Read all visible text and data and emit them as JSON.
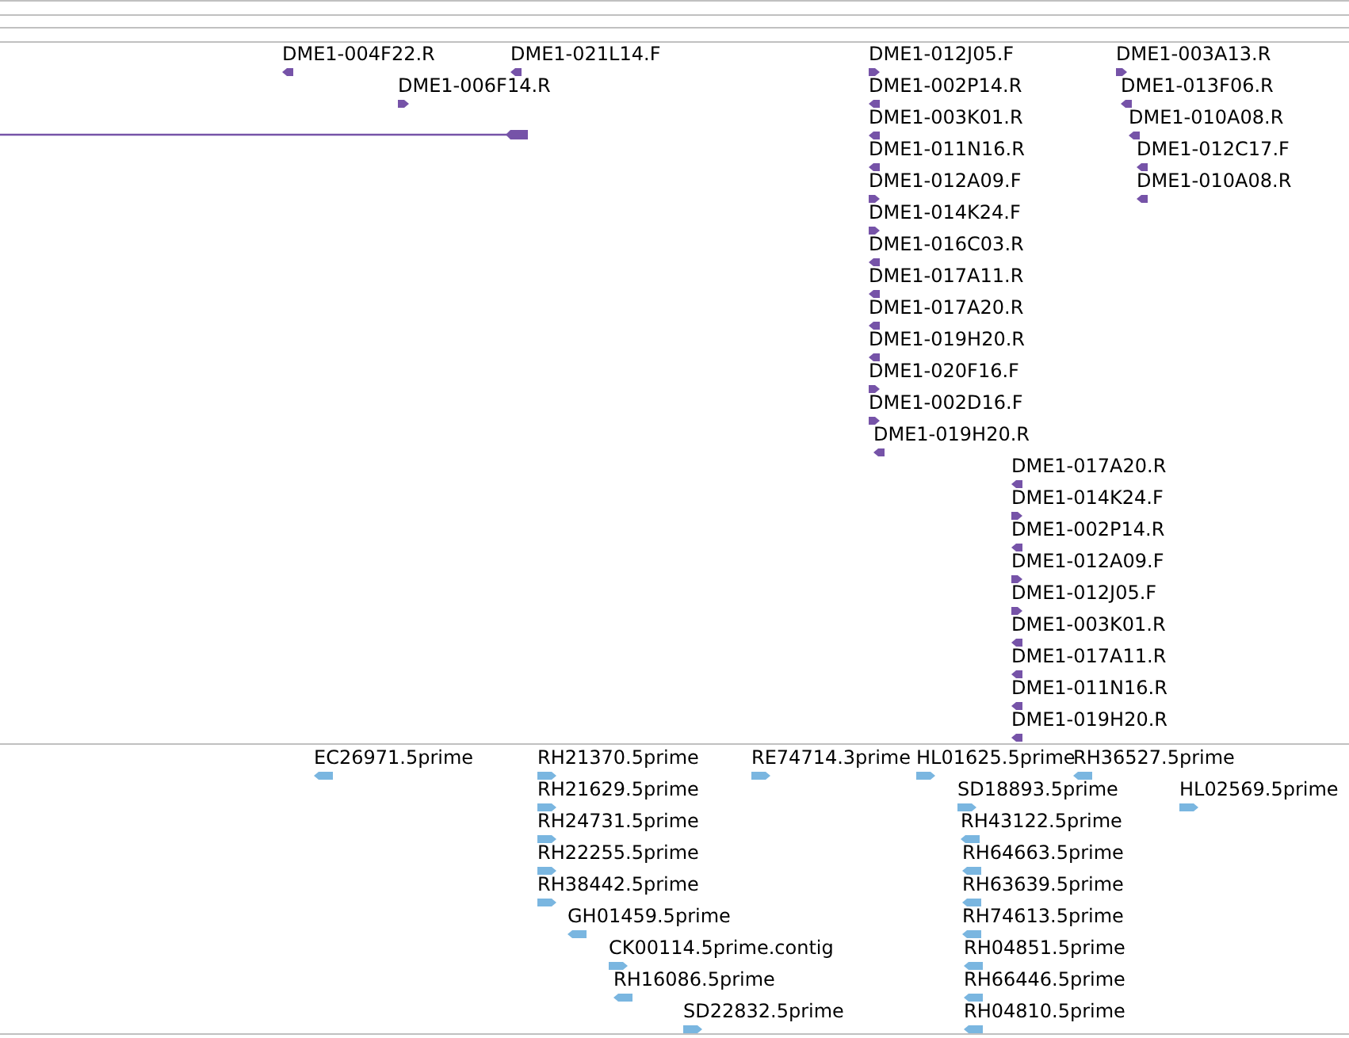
{
  "tracks": [
    {
      "kind": "purple",
      "features": [
        {
          "label": "DME1-004F22.R",
          "kind": "reverse"
        },
        {
          "label": "DME1-021L14.F",
          "kind": "reverse"
        },
        {
          "label": "DME1-006F14.R",
          "kind": "forward"
        },
        {
          "label": "DME1-012J05.F",
          "kind": "forward"
        },
        {
          "label": "DME1-002P14.R",
          "kind": "reverse"
        },
        {
          "label": "DME1-003K01.R",
          "kind": "reverse"
        },
        {
          "label": "DME1-011N16.R",
          "kind": "reverse"
        },
        {
          "label": "DME1-012A09.F",
          "kind": "forward"
        },
        {
          "label": "DME1-014K24.F",
          "kind": "forward"
        },
        {
          "label": "DME1-016C03.R",
          "kind": "reverse"
        },
        {
          "label": "DME1-017A11.R",
          "kind": "reverse"
        },
        {
          "label": "DME1-017A20.R",
          "kind": "reverse"
        },
        {
          "label": "DME1-019H20.R",
          "kind": "reverse"
        },
        {
          "label": "DME1-020F16.F",
          "kind": "forward"
        },
        {
          "label": "DME1-002D16.F",
          "kind": "forward"
        },
        {
          "label": "DME1-019H20.R",
          "kind": "reverse"
        },
        {
          "label": "DME1-003A13.R",
          "kind": "forward"
        },
        {
          "label": "DME1-013F06.R",
          "kind": "reverse"
        },
        {
          "label": "DME1-010A08.R",
          "kind": "reverse"
        },
        {
          "label": "DME1-012C17.F",
          "kind": "reverse"
        },
        {
          "label": "DME1-010A08.R",
          "kind": "reverse"
        },
        {
          "label": "DME1-017A20.R",
          "kind": "reverse"
        },
        {
          "label": "DME1-014K24.F",
          "kind": "forward"
        },
        {
          "label": "DME1-002P14.R",
          "kind": "reverse"
        },
        {
          "label": "DME1-012A09.F",
          "kind": "forward"
        },
        {
          "label": "DME1-012J05.F",
          "kind": "forward"
        },
        {
          "label": "DME1-003K01.R",
          "kind": "reverse"
        },
        {
          "label": "DME1-017A11.R",
          "kind": "reverse"
        },
        {
          "label": "DME1-011N16.R",
          "kind": "reverse"
        },
        {
          "label": "DME1-019H20.R",
          "kind": "reverse"
        }
      ]
    },
    {
      "kind": "blue",
      "features": [
        {
          "label": "EC26971.5prime",
          "kind": "reverse"
        },
        {
          "label": "RH21370.5prime",
          "kind": "forward"
        },
        {
          "label": "RH21629.5prime",
          "kind": "forward"
        },
        {
          "label": "RH24731.5prime",
          "kind": "forward"
        },
        {
          "label": "RH22255.5prime",
          "kind": "forward"
        },
        {
          "label": "RH38442.5prime",
          "kind": "forward"
        },
        {
          "label": "GH01459.5prime",
          "kind": "reverse"
        },
        {
          "label": "CK00114.5prime.contig",
          "kind": "forward"
        },
        {
          "label": "RH16086.5prime",
          "kind": "reverse"
        },
        {
          "label": "SD22832.5prime",
          "kind": "forward"
        },
        {
          "label": "RE74714.3prime",
          "kind": "forward"
        },
        {
          "label": "HL01625.5prime",
          "kind": "forward"
        },
        {
          "label": "RH36527.5prime",
          "kind": "reverse"
        },
        {
          "label": "SD18893.5prime",
          "kind": "forward"
        },
        {
          "label": "HL02569.5prime",
          "kind": "forward"
        },
        {
          "label": "RH43122.5prime",
          "kind": "reverse"
        },
        {
          "label": "RH64663.5prime",
          "kind": "reverse"
        },
        {
          "label": "RH63639.5prime",
          "kind": "reverse"
        },
        {
          "label": "RH74613.5prime",
          "kind": "reverse"
        },
        {
          "label": "RH04851.5prime",
          "kind": "reverse"
        },
        {
          "label": "RH66446.5prime",
          "kind": "reverse"
        },
        {
          "label": "RH04810.5prime",
          "kind": "reverse"
        }
      ]
    }
  ]
}
